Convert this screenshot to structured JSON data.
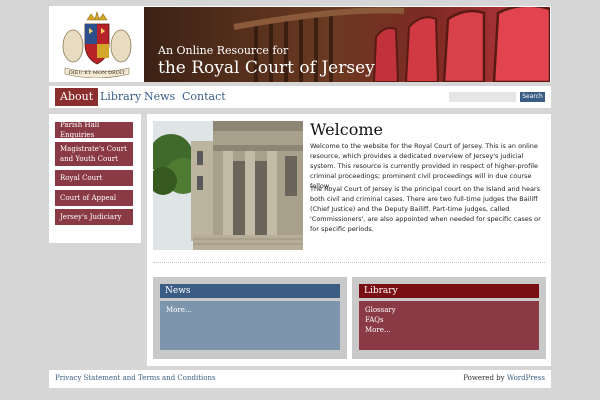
{
  "header": {
    "tagline_small": "An Online Resource for",
    "tagline_big": "the Royal Court of Jersey"
  },
  "nav": {
    "items": [
      {
        "label": "About",
        "active": true
      },
      {
        "label": "Library",
        "active": false
      },
      {
        "label": "News",
        "active": false
      },
      {
        "label": "Contact",
        "active": false
      }
    ],
    "search_button": "Search"
  },
  "sidebar": {
    "items": [
      {
        "label": "Parish Hall Enquiries"
      },
      {
        "label": "Magistrate's Court and Youth Court"
      },
      {
        "label": "Royal Court"
      },
      {
        "label": "Court of Appeal"
      },
      {
        "label": "Jersey's Judiciary"
      }
    ]
  },
  "main": {
    "title": "Welcome",
    "paragraph1": "Welcome to the website for the Royal Court of Jersey. This is an online resource, which provides a dedicated overview of Jersey's judicial system. This resource is currently provided in respect of higher-profile criminal proceedings; prominent civil proceedings will in due course follow.",
    "paragraph2": "The Royal Court of Jersey is the principal court on the Island and hears both civil and criminal cases. There are two full-time judges the Bailiff (Chief Justice) and the Deputy Bailiff. Part-time judges, called 'Commissioners', are also appointed when needed for specific cases or for specific periods."
  },
  "news": {
    "title": "News",
    "links": [
      "More..."
    ]
  },
  "library": {
    "title": "Library",
    "links": [
      "Glossary",
      "FAQs",
      "More..."
    ]
  },
  "footer": {
    "left_link": "Privacy Statement and Terms and Conditions",
    "powered_by": "Powered by",
    "powered_link": "WordPress"
  },
  "colors": {
    "accent_red": "#8a2e2e",
    "nav_blue": "#3b5d85",
    "news_header": "#3b5d85",
    "news_body": "#7e96ad",
    "library_header": "#7a0f13",
    "library_body": "#8a3a45"
  }
}
